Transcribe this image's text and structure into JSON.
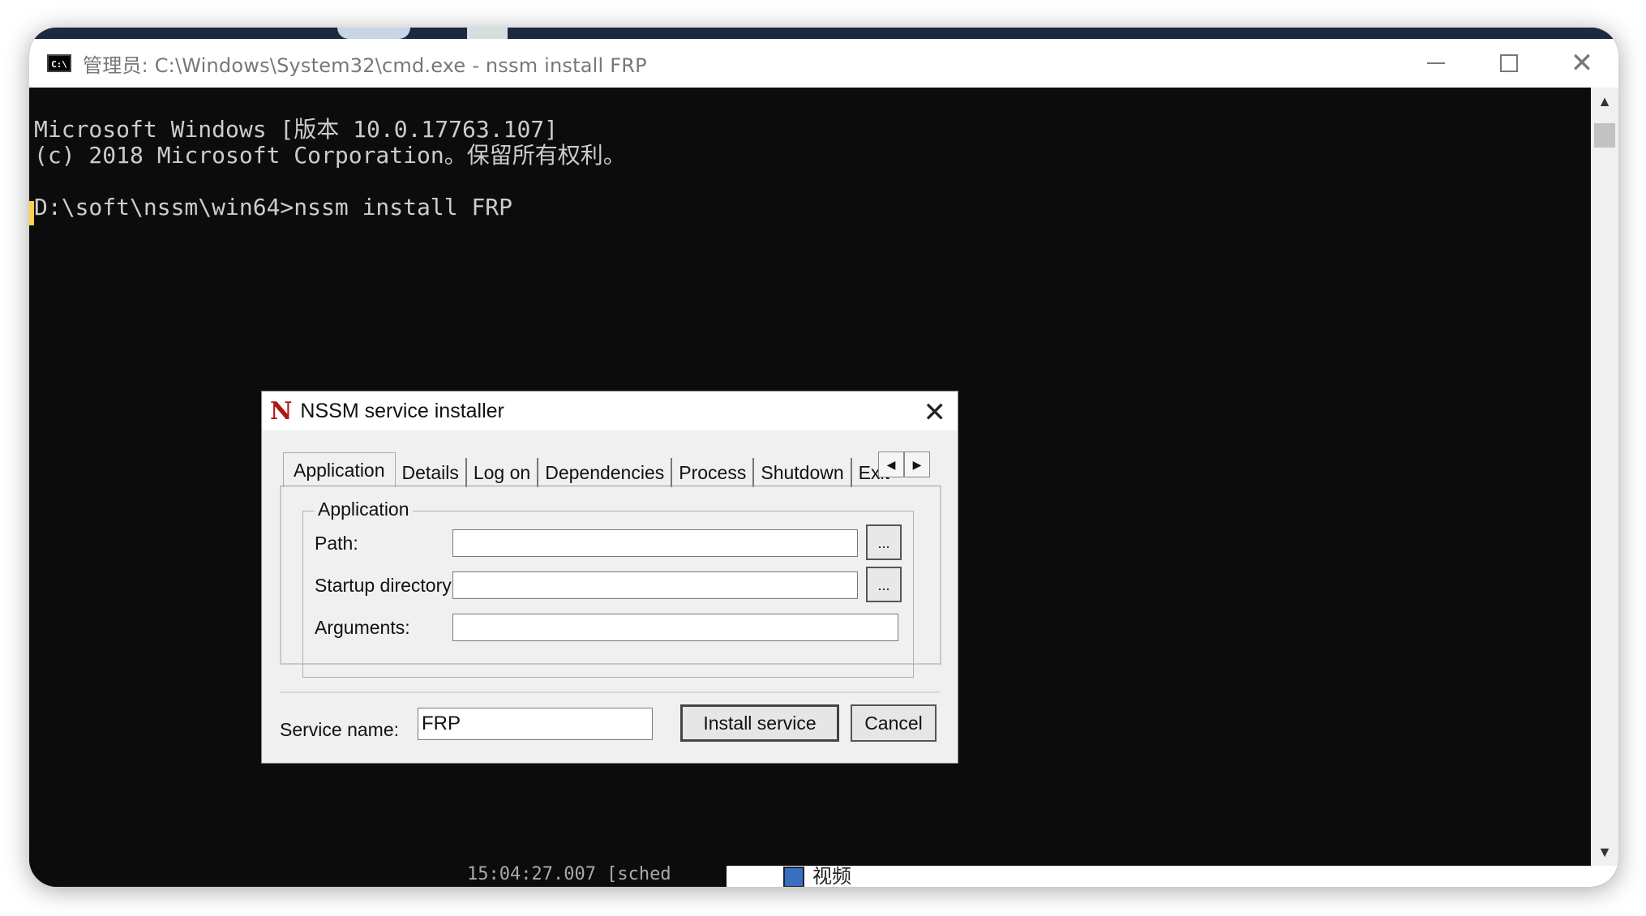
{
  "window": {
    "title": "管理员: C:\\Windows\\System32\\cmd.exe - nssm  install FRP"
  },
  "console": {
    "lines": [
      "Microsoft Windows [版本 10.0.17763.107]",
      "(c) 2018 Microsoft Corporation。保留所有权利。",
      "D:\\soft\\nssm\\win64>nssm install FRP"
    ],
    "bottom_peek": "15:04:27.007 [sched"
  },
  "taskbar": {
    "video_label": "视频"
  },
  "dialog": {
    "title": "NSSM service installer",
    "logo_letter": "N",
    "tabs": [
      "Application",
      "Details",
      "Log on",
      "Dependencies",
      "Process",
      "Shutdown",
      "Exit"
    ],
    "active_tab": "Application",
    "group_title": "Application",
    "fields": {
      "path_label": "Path:",
      "path_value": "",
      "startup_label": "Startup directory:",
      "startup_value": "",
      "arguments_label": "Arguments:",
      "arguments_value": ""
    },
    "browse_label": "...",
    "service_name_label": "Service name:",
    "service_name_value": "FRP",
    "install_label": "Install service",
    "cancel_label": "Cancel"
  }
}
